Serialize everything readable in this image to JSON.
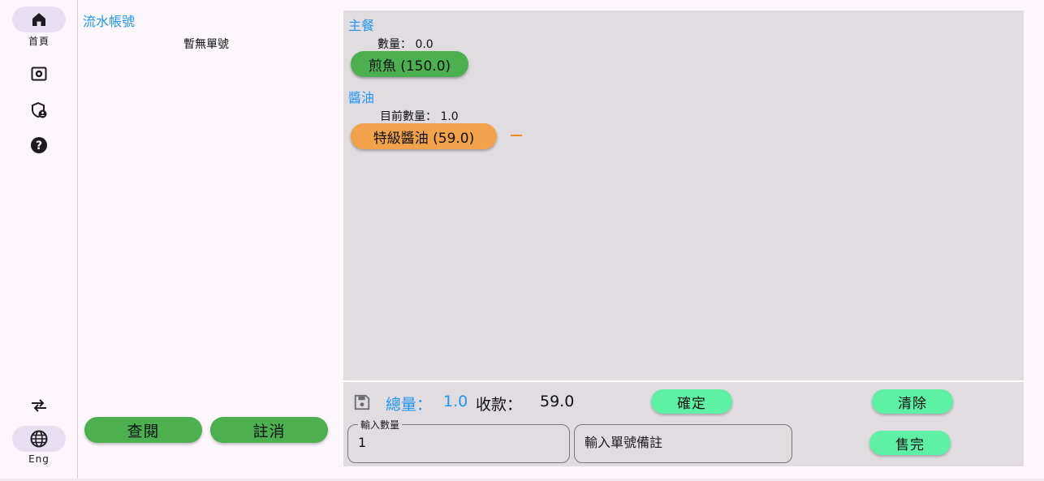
{
  "rail": {
    "home_label": "首頁",
    "lang_label": "Eng"
  },
  "order_pane": {
    "title": "流水帳號",
    "empty_text": "暫無單號",
    "view_button": "查閱",
    "cancel_button": "註消"
  },
  "menu": {
    "categories": [
      {
        "title": "主餐",
        "qty_label": "數量： 0.0",
        "items": [
          {
            "label": "煎魚 (150.0)",
            "color": "#4caf50"
          }
        ]
      },
      {
        "title": "醬油",
        "qty_label": "目前數量： 1.0",
        "items": [
          {
            "label": "特級醬油 (59.0)",
            "color": "#f2a24a"
          }
        ]
      }
    ]
  },
  "summary": {
    "total_label": "總量：",
    "total_value": "1.0",
    "pay_label": "收款：",
    "pay_value": "59.0",
    "confirm_button": "確定",
    "clear_button": "清除",
    "sold_out_button": "售完",
    "qty_field_label": "輸入數量",
    "qty_field_value": "1",
    "note_placeholder": "輸入單號備註"
  },
  "colors": {
    "accent_blue": "#2196f3",
    "green": "#4caf50",
    "mint": "#5ef0a4",
    "orange": "#f2a24a"
  }
}
